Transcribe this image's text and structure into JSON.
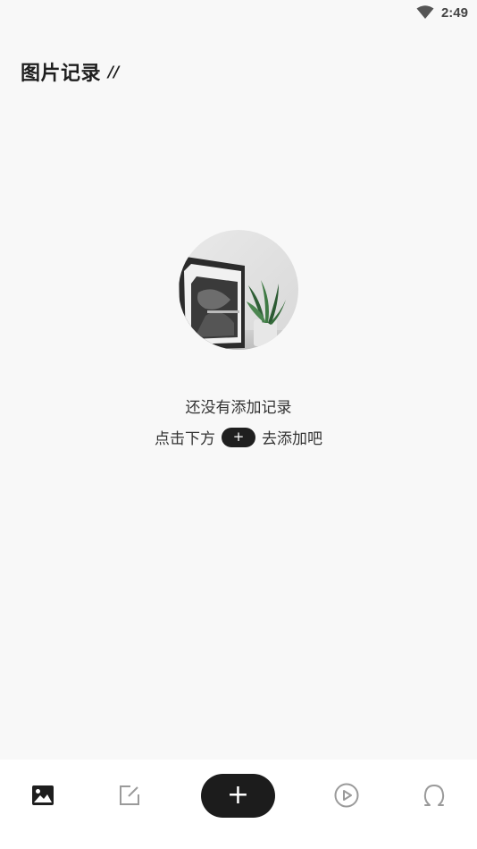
{
  "status_bar": {
    "time": "2:49",
    "icons": [
      "wifi-icon"
    ]
  },
  "header": {
    "title": "图片记录",
    "title_decoration": "//"
  },
  "empty_state": {
    "image_icon": "framed-poster-with-plant-photo",
    "title": "还没有添加记录",
    "hint_prefix": "点击下方",
    "hint_plus": "+",
    "hint_suffix": "去添加吧"
  },
  "bottom_nav": {
    "items": [
      {
        "icon": "image-icon",
        "active": true
      },
      {
        "icon": "edit-note-icon",
        "active": false
      },
      {
        "icon": "plus-icon",
        "label": "+",
        "active": false
      },
      {
        "icon": "play-circle-icon",
        "active": false
      },
      {
        "icon": "profile-icon",
        "active": false
      }
    ],
    "colors": {
      "active": "#1e1e1e",
      "inactive": "#9a9a9a",
      "add_button": "#1c1c1c"
    }
  }
}
